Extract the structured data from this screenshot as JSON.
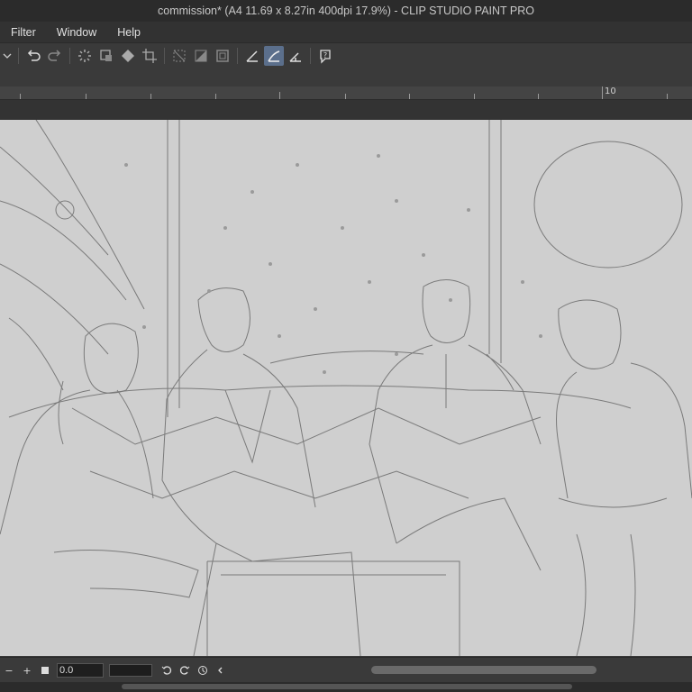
{
  "window": {
    "title": "commission* (A4 11.69 x 8.27in 400dpi 17.9%)  - CLIP STUDIO PAINT PRO"
  },
  "menu": {
    "items": [
      "Filter",
      "Window",
      "Help"
    ]
  },
  "toolbar": {
    "buttons": [
      "undo-icon",
      "redo-icon",
      "loading-icon",
      "transform-icon",
      "fill-icon",
      "crop-icon",
      "deselect-icon",
      "invert-selection-icon",
      "selection-border-icon",
      "ruler-snap-icon",
      "special-ruler-snap-icon",
      "grid-snap-icon",
      "help-icon"
    ],
    "active": "special-ruler-snap-icon",
    "accent": "#5b6f8c"
  },
  "ruler": {
    "label": "10"
  },
  "bottom": {
    "zoom_value": "0.0",
    "minus": "−",
    "plus": "+"
  }
}
